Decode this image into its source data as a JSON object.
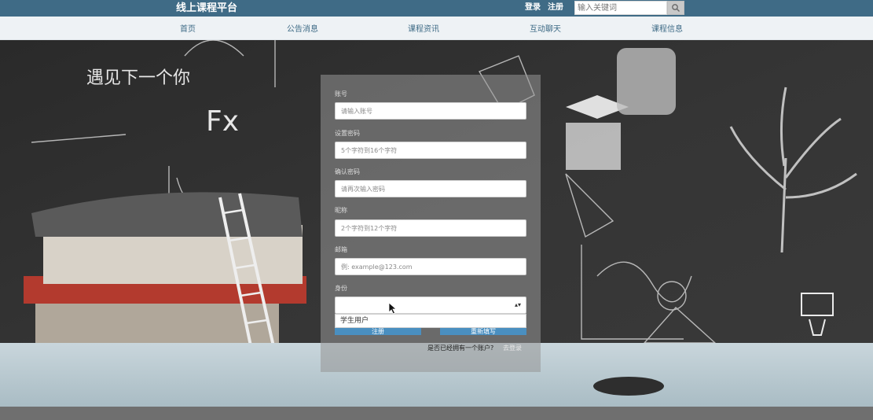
{
  "header": {
    "site_title": "线上课程平台",
    "login": "登录",
    "register": "注册",
    "search_placeholder": "输入关键词"
  },
  "nav": {
    "items": [
      "首页",
      "公告消息",
      "课程资讯",
      "互动聊天",
      "课程信息"
    ]
  },
  "background": {
    "chalk_text": "遇见下一个你",
    "formula_fx": "Fx"
  },
  "form": {
    "account_label": "账号",
    "account_placeholder": "请输入账号",
    "password_label": "设置密码",
    "password_placeholder": "5个字符到16个字符",
    "confirm_label": "确认密码",
    "confirm_placeholder": "请再次输入密码",
    "name_label": "昵称",
    "name_placeholder": "2个字符到12个字符",
    "email_label": "邮箱",
    "email_placeholder": "例: example@123.com",
    "role_label": "身份",
    "role_selected": "",
    "role_options": [
      "学生用户"
    ],
    "submit_label": "注册",
    "reset_label": "重新填写",
    "has_account_text": "是否已经拥有一个账户?",
    "go_login_text": "去登录"
  },
  "colors": {
    "header_bg": "#3f6b86",
    "nav_text": "#3f6b86",
    "button_bg": "#4a8fc0"
  }
}
